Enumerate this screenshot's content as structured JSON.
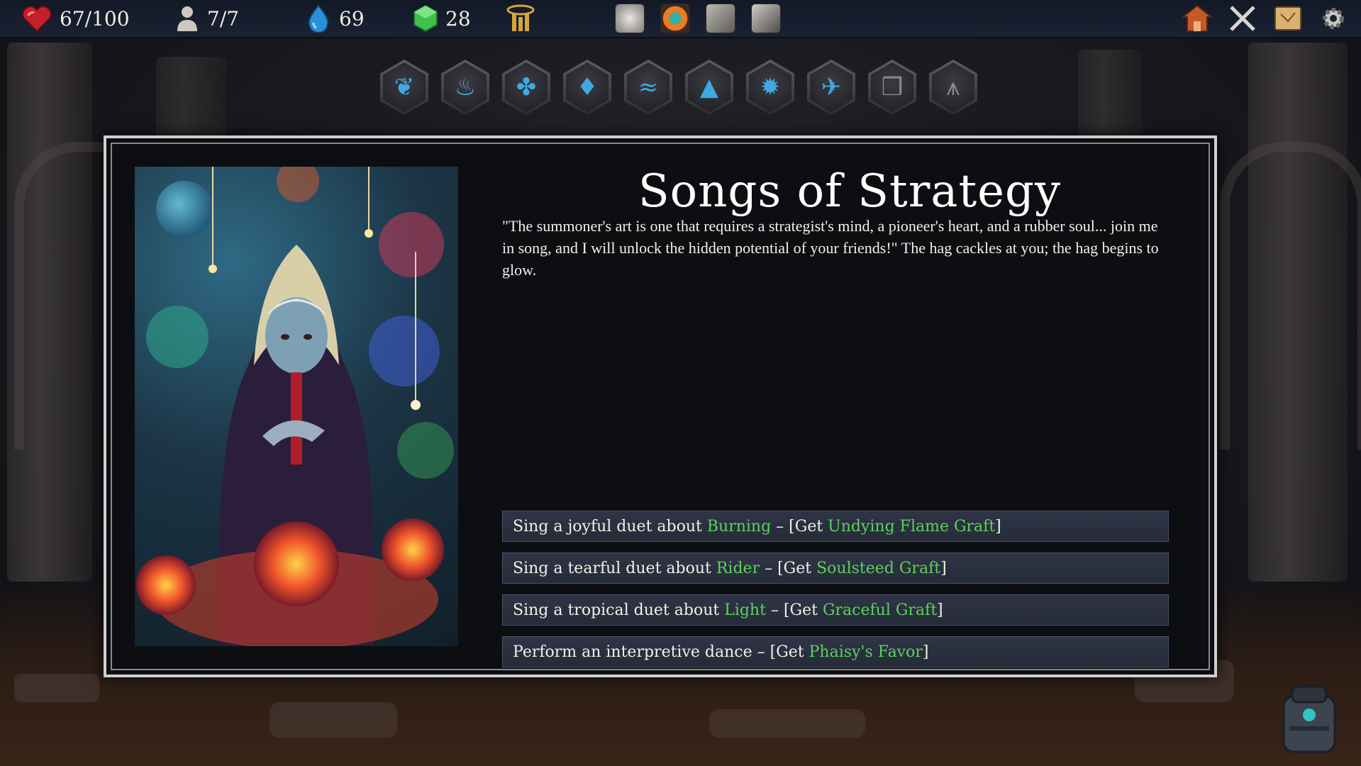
{
  "hud": {
    "health": "67/100",
    "party": "7/7",
    "mana": "69",
    "gems": "28",
    "colors": {
      "health": "#c3202b",
      "mana": "#2a8fd6",
      "gem": "#3cc24a",
      "accent": "#3fa9e6"
    },
    "center_icons": [
      "relic-gear-icon",
      "relic-eye-icon",
      "relic-helm-icon",
      "relic-a-icon"
    ],
    "nav_icons": [
      "home-icon",
      "crossed-tools-icon",
      "map-icon",
      "settings-gear-icon"
    ]
  },
  "skills": [
    {
      "name": "leaf-skill-icon",
      "glyph": "❦"
    },
    {
      "name": "fire-skill-icon",
      "glyph": "♨"
    },
    {
      "name": "triquetra-skill-icon",
      "glyph": "✤"
    },
    {
      "name": "water-skill-icon",
      "glyph": "♦"
    },
    {
      "name": "wave-skill-icon",
      "glyph": "≈"
    },
    {
      "name": "hat-skill-icon",
      "glyph": "▲"
    },
    {
      "name": "sun-skill-icon",
      "glyph": "✹"
    },
    {
      "name": "bird-skill-icon",
      "glyph": "✈"
    },
    {
      "name": "book-skill-icon",
      "glyph": "❒"
    },
    {
      "name": "rune-skill-icon",
      "glyph": "⩚"
    }
  ],
  "event": {
    "title": "Songs of Strategy",
    "description": "\"The summoner's art is one that requires a strategist's mind, a pioneer's heart, and a rubber soul... join me in song, and I will unlock the hidden potential of your friends!\" The hag cackles at you; the hag begins to glow.",
    "choices": [
      {
        "prefix": "Sing a joyful duet about ",
        "topic": "Burning",
        "mid": " – [Get ",
        "reward": "Undying Flame Graft",
        "suffix": "]"
      },
      {
        "prefix": "Sing a tearful duet about ",
        "topic": "Rider",
        "mid": " – [Get ",
        "reward": "Soulsteed Graft",
        "suffix": "]"
      },
      {
        "prefix": "Sing a tropical duet about ",
        "topic": "Light",
        "mid": " – [Get ",
        "reward": "Graceful Graft",
        "suffix": "]"
      },
      {
        "prefix": "Perform an interpretive dance",
        "topic": "",
        "mid": " – [Get ",
        "reward": "Phaisy's Favor",
        "suffix": "]"
      }
    ]
  }
}
